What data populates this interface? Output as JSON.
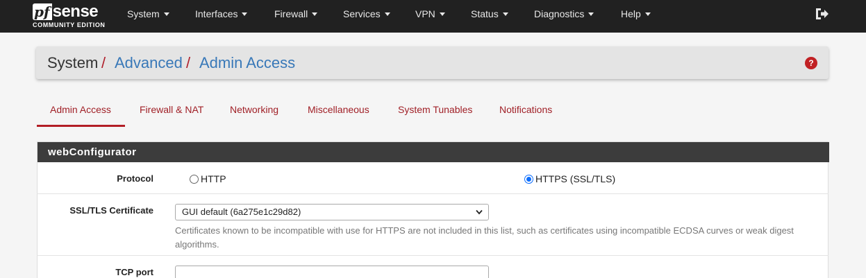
{
  "brand": {
    "logo_pf": "pf",
    "logo_sense": "sense",
    "edition": "COMMUNITY EDITION"
  },
  "nav": {
    "items": [
      {
        "label": "System"
      },
      {
        "label": "Interfaces"
      },
      {
        "label": "Firewall"
      },
      {
        "label": "Services"
      },
      {
        "label": "VPN"
      },
      {
        "label": "Status"
      },
      {
        "label": "Diagnostics"
      },
      {
        "label": "Help"
      }
    ],
    "logout_icon": "sign-out-icon"
  },
  "breadcrumb": {
    "items": [
      "System",
      "Advanced",
      "Admin Access"
    ],
    "separator": "/",
    "help_icon_glyph": "?"
  },
  "tabs": [
    {
      "label": "Admin Access",
      "active": true
    },
    {
      "label": "Firewall & NAT"
    },
    {
      "label": "Networking"
    },
    {
      "label": "Miscellaneous"
    },
    {
      "label": "System Tunables"
    },
    {
      "label": "Notifications"
    }
  ],
  "panel": {
    "title": "webConfigurator",
    "protocol": {
      "label": "Protocol",
      "options": [
        {
          "label": "HTTP",
          "checked": false
        },
        {
          "label": "HTTPS (SSL/TLS)",
          "checked": true
        }
      ]
    },
    "ssl_certificate": {
      "label": "SSL/TLS Certificate",
      "selected": "GUI default (6a275e1c29d82)",
      "help": "Certificates known to be incompatible with use for HTTPS are not included in this list, such as certificates using incompatible ECDSA curves or weak digest algorithms."
    },
    "tcp_port": {
      "label": "TCP port",
      "value": ""
    }
  },
  "colors": {
    "navbar_bg": "#212121",
    "accent_red": "#b31e25",
    "link_blue": "#3878b8",
    "panel_header": "#3c3c3c",
    "radio_blue": "#0d6efd"
  }
}
